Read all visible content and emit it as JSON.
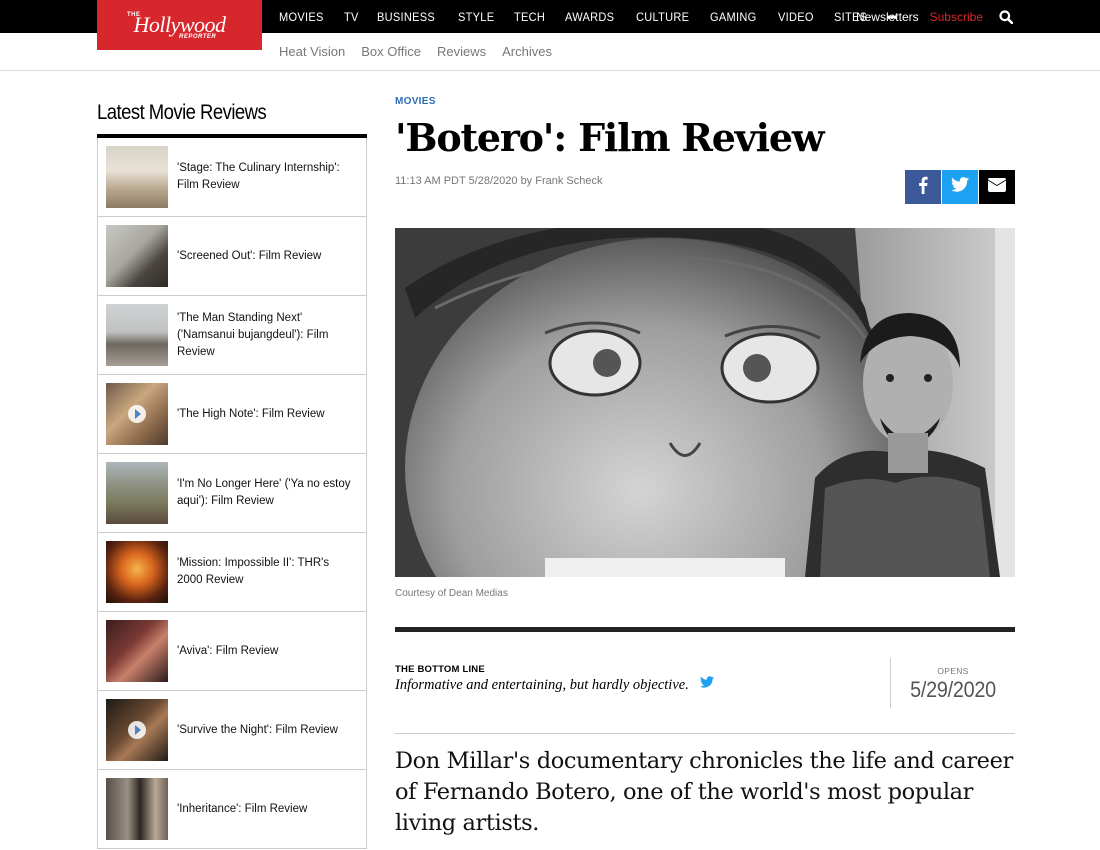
{
  "site": {
    "logo_the": "THE",
    "logo_main": "Hollywood",
    "logo_reporter": "REPORTER",
    "brand_color": "#d8262d"
  },
  "nav": {
    "main": [
      "MOVIES",
      "TV",
      "BUSINESS",
      "STYLE",
      "TECH",
      "AWARDS",
      "CULTURE",
      "GAMING",
      "VIDEO",
      "SITES"
    ],
    "more_glyph": "•••",
    "newsletters": "Newsletters",
    "subscribe": "Subscribe",
    "search_icon": "search-icon"
  },
  "subnav": [
    "Heat Vision",
    "Box Office",
    "Reviews",
    "Archives"
  ],
  "sidebar": {
    "title": "Latest Movie Reviews",
    "items": [
      {
        "title": "'Stage: The Culinary Internship': Film Review",
        "video": false
      },
      {
        "title": "'Screened Out': Film Review",
        "video": false
      },
      {
        "title": "'The Man Standing Next' ('Namsanui bujangdeul'): Film Review",
        "video": false
      },
      {
        "title": "'The High Note': Film Review",
        "video": true
      },
      {
        "title": "'I'm No Longer Here' ('Ya no estoy aqui'): Film Review",
        "video": false
      },
      {
        "title": "'Mission: Impossible II': THR's 2000 Review",
        "video": false
      },
      {
        "title": "'Aviva': Film Review",
        "video": false
      },
      {
        "title": "'Survive the Night': Film Review",
        "video": true
      },
      {
        "title": "'Inheritance': Film Review",
        "video": false
      }
    ]
  },
  "article": {
    "section": "MOVIES",
    "headline": "'Botero': Film Review",
    "timestamp": "11:13 AM PDT 5/28/2020 by",
    "author": "Frank Scheck",
    "share": {
      "facebook": "facebook-icon",
      "twitter": "twitter-icon",
      "email": "email-icon"
    },
    "caption": "Courtesy of Dean Medias",
    "bottom_line_label": "THE BOTTOM LINE",
    "bottom_line": "Informative and entertaining, but hardly objective.",
    "opens_label": "OPENS",
    "opens_date": "5/29/2020",
    "lede": "Don Millar's documentary chronicles the life and career of Fernando Botero, one of the world's most popular living artists."
  }
}
